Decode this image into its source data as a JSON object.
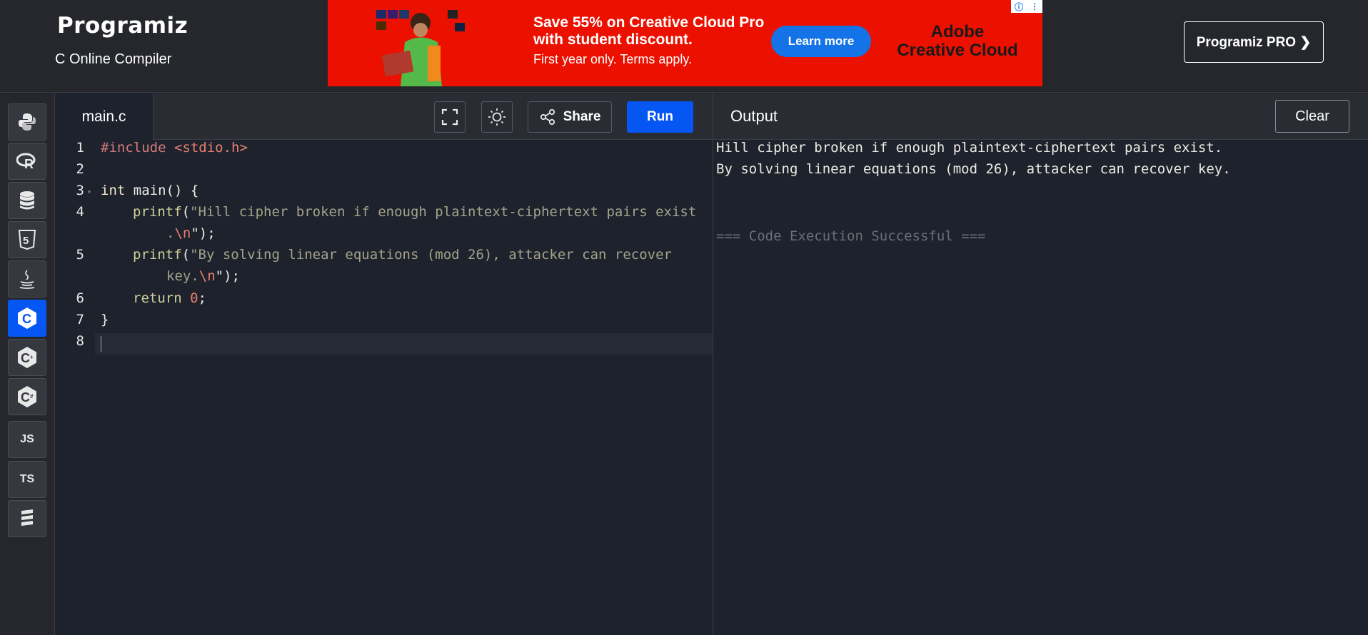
{
  "header": {
    "logo": "Programiz",
    "subtitle": "C Online Compiler",
    "pro_button": "Programiz PRO ❯"
  },
  "ad": {
    "headline_line1": "Save 55% on Creative Cloud Pro",
    "headline_line2": "with student discount.",
    "subline": "First year only. Terms apply.",
    "cta": "Learn more",
    "brand_line1": "Adobe",
    "brand_line2": "Creative Cloud",
    "info_icon": "ⓘ",
    "menu_icon": "⋮",
    "color": "#eb1000"
  },
  "sidebar": {
    "items": [
      {
        "name": "python",
        "icon": "python-icon"
      },
      {
        "name": "r",
        "icon": "r-icon"
      },
      {
        "name": "sql",
        "icon": "database-icon"
      },
      {
        "name": "html",
        "icon": "html5-icon",
        "label": "5"
      },
      {
        "name": "java",
        "icon": "java-icon"
      },
      {
        "name": "c",
        "icon": "c-icon",
        "label": "C",
        "active": true
      },
      {
        "name": "cpp",
        "icon": "cpp-icon",
        "label": "C"
      },
      {
        "name": "csharp",
        "icon": "csharp-icon",
        "label": "C"
      },
      {
        "name": "javascript",
        "label": "JS"
      },
      {
        "name": "typescript",
        "label": "TS"
      },
      {
        "name": "swift",
        "icon": "swift-icon"
      }
    ]
  },
  "editor": {
    "filename": "main.c",
    "share_label": "Share",
    "run_label": "Run",
    "line_numbers": [
      "1",
      "2",
      "3",
      "4",
      "5",
      "6",
      "7",
      "8"
    ],
    "lines": {
      "l1_pre": "#include ",
      "l1_inc": "<stdio.h>",
      "l3_kw": "int",
      "l3_rest": " main() {",
      "l4_fn": "printf",
      "l4_open": "(",
      "l4_str": "\"Hill cipher broken if enough plaintext-ciphertext pairs exist",
      "l4b_str": ".",
      "l4b_esc": "\\n",
      "l4b_end": "\");",
      "l5_fn": "printf",
      "l5_open": "(",
      "l5_str": "\"By solving linear equations (mod 26), attacker can recover",
      "l5b_str": "key.",
      "l5b_esc": "\\n",
      "l5b_end": "\");",
      "l6_kw": "return",
      "l6_num": "0",
      "l6_end": ";",
      "l7": "}"
    }
  },
  "output": {
    "title": "Output",
    "clear_label": "Clear",
    "lines": [
      "Hill cipher broken if enough plaintext-ciphertext pairs exist.",
      "By solving linear equations (mod 26), attacker can recover key."
    ],
    "status": "=== Code Execution Successful ==="
  },
  "colors": {
    "accent": "#0556f3",
    "background": "#1e222d",
    "panel": "#25272d"
  }
}
